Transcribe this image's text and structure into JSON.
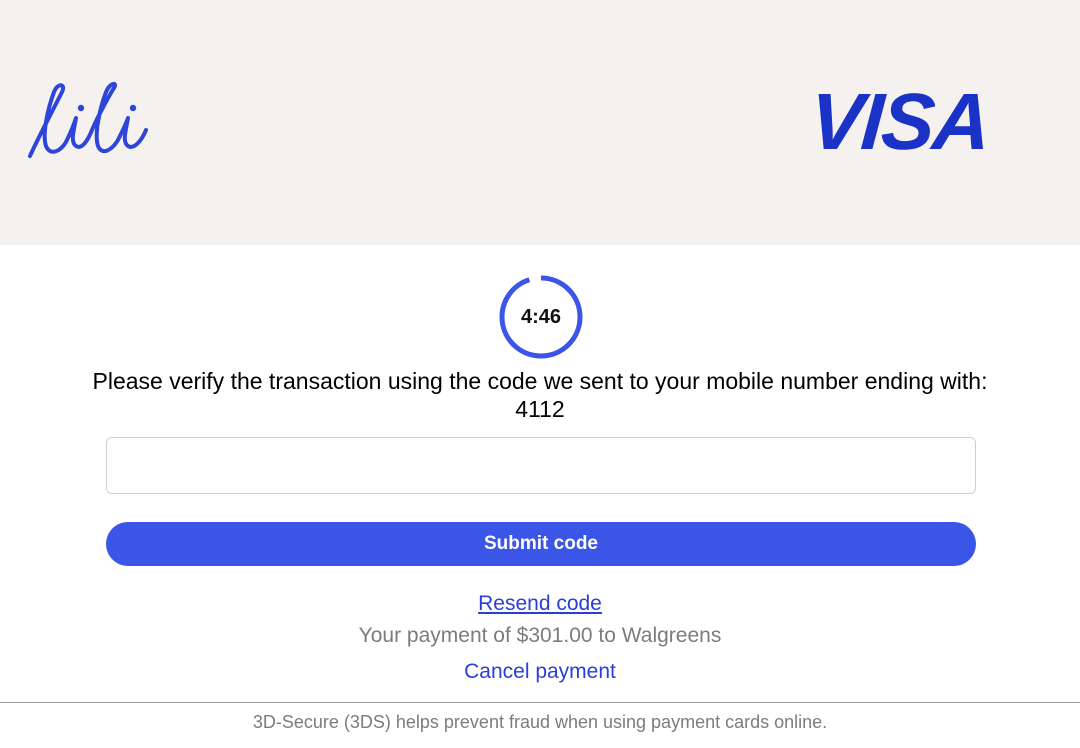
{
  "header": {
    "issuer_logo": "lili",
    "network_logo": "VISA",
    "background_color": "#f4f1ee",
    "logo_color": "#2d45d8",
    "visa_color": "#1a33c6"
  },
  "timer": {
    "value": "4:46",
    "ring_color": "#3b55e6",
    "remaining_fraction": 0.95
  },
  "verification": {
    "message": "Please verify the transaction using the code we sent to your mobile number ending with: 4112"
  },
  "code_field": {
    "value": "",
    "placeholder": ""
  },
  "actions": {
    "submit_label": "Submit code",
    "submit_color": "#3b55e6",
    "resend_label": "Resend code",
    "cancel_label": "Cancel payment"
  },
  "payment": {
    "summary": "Your payment of $301.00 to Walgreens"
  },
  "footer": {
    "note": "3D-Secure (3DS) helps prevent fraud when using payment cards online."
  }
}
